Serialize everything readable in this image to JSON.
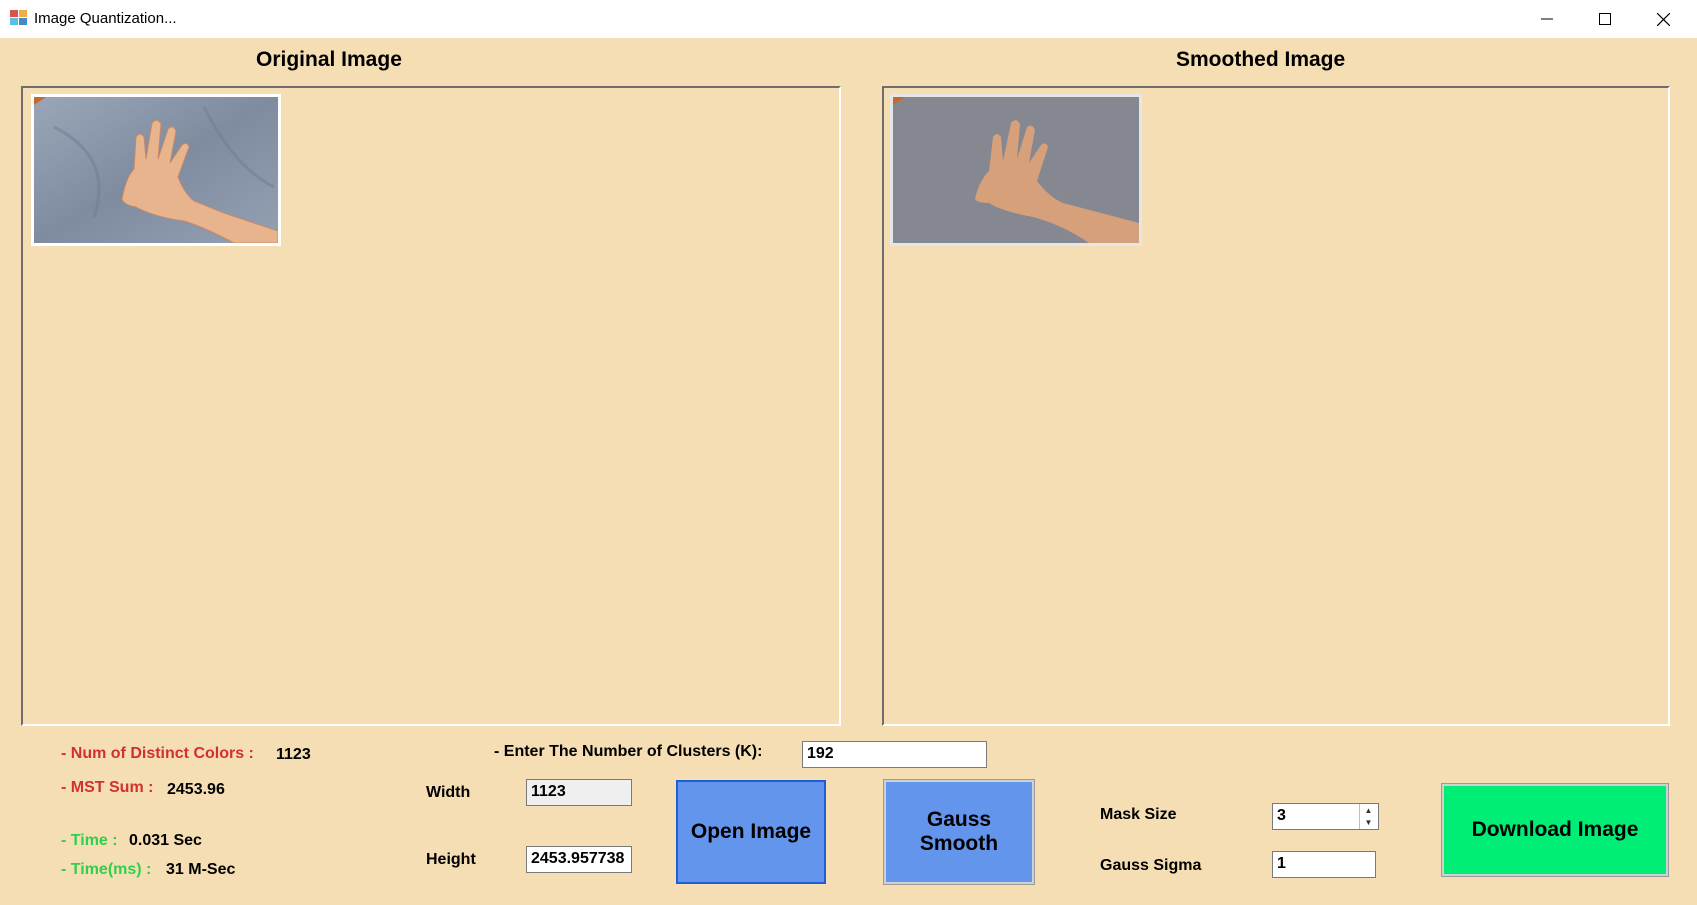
{
  "window": {
    "title": "Image Quantization..."
  },
  "panels": {
    "original_title": "Original Image",
    "smoothed_title": "Smoothed Image"
  },
  "info": {
    "distinct_colors_label": "- Num of Distinct Colors :",
    "distinct_colors_value": "1123",
    "mst_sum_label": "- MST Sum :",
    "mst_sum_value": "2453.96",
    "time_label": "- Time :",
    "time_value": "0.031 Sec",
    "time_ms_label": "- Time(ms) :",
    "time_ms_value": "31 M-Sec"
  },
  "clusters": {
    "label": "- Enter The Number of Clusters (K):",
    "value": "192"
  },
  "dimensions": {
    "width_label": "Width",
    "width_value": "1123",
    "height_label": "Height",
    "height_value": "2453.957738"
  },
  "buttons": {
    "open": "Open Image",
    "gauss_line1": "Gauss",
    "gauss_line2": "Smooth",
    "download": "Download Image"
  },
  "gauss": {
    "mask_size_label": "Mask Size",
    "mask_size_value": "3",
    "sigma_label": "Gauss Sigma",
    "sigma_value": "1"
  },
  "colors": {
    "background": "#f5deb3",
    "button_blue": "#6495ed",
    "button_green": "#00ee76",
    "label_red": "#d2302f",
    "label_green": "#2fd04a"
  }
}
